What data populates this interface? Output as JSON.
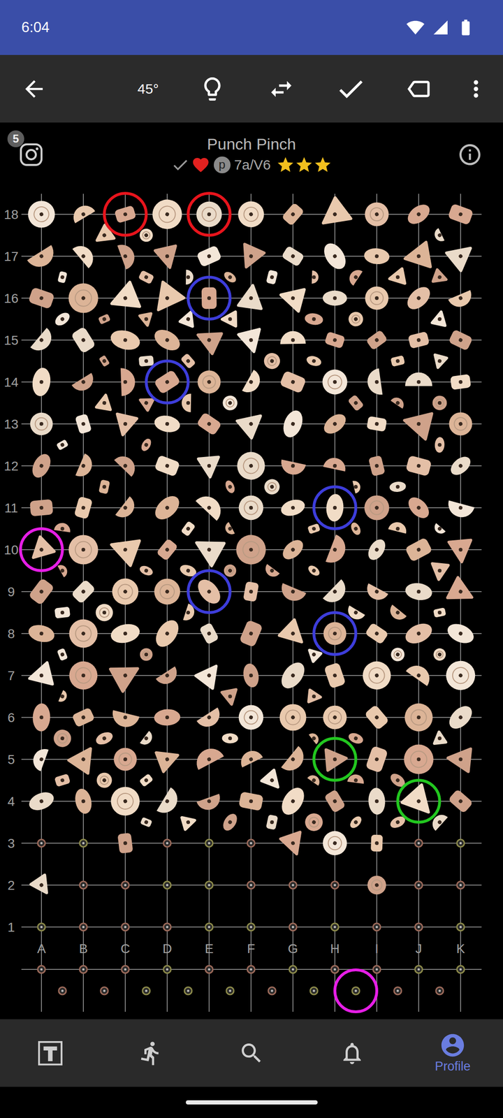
{
  "status_bar": {
    "time": "6:04"
  },
  "toolbar": {
    "angle": "45°"
  },
  "climb": {
    "title": "Punch Pinch",
    "instagram_count": "5",
    "sent": false,
    "liked": true,
    "badge": "p",
    "grade": "7a/V6",
    "stars": 3
  },
  "board": {
    "rows": [
      "18",
      "17",
      "16",
      "15",
      "14",
      "13",
      "12",
      "11",
      "10",
      "9",
      "8",
      "7",
      "6",
      "5",
      "4",
      "3",
      "2",
      "1"
    ],
    "columns": [
      "A",
      "B",
      "C",
      "D",
      "E",
      "F",
      "G",
      "H",
      "I",
      "J",
      "K"
    ],
    "holds": [
      {
        "col": "C",
        "row": "18",
        "color": "#e8141c"
      },
      {
        "col": "E",
        "row": "18",
        "color": "#e8141c"
      },
      {
        "col": "E",
        "row": "16",
        "color": "#3d3ddb"
      },
      {
        "col": "D",
        "row": "14",
        "color": "#3d3ddb"
      },
      {
        "col": "H",
        "row": "11",
        "color": "#3d3ddb"
      },
      {
        "col": "E",
        "row": "9",
        "color": "#3d3ddb"
      },
      {
        "col": "H",
        "row": "8",
        "color": "#3d3ddb"
      },
      {
        "col": "H",
        "row": "5",
        "color": "#22c71f"
      },
      {
        "col": "J",
        "row": "4",
        "color": "#22c71f"
      },
      {
        "col": "A",
        "row": "10",
        "color": "#e61ee6"
      },
      {
        "col": "H",
        "row": "kick",
        "color": "#e61ee6"
      }
    ]
  },
  "bottom_nav": {
    "items": [
      {
        "kind": "logo",
        "selected": false
      },
      {
        "kind": "climb",
        "selected": false
      },
      {
        "kind": "search",
        "selected": false
      },
      {
        "kind": "bell",
        "selected": false
      },
      {
        "kind": "profile",
        "label": "Profile",
        "selected": true
      }
    ]
  }
}
